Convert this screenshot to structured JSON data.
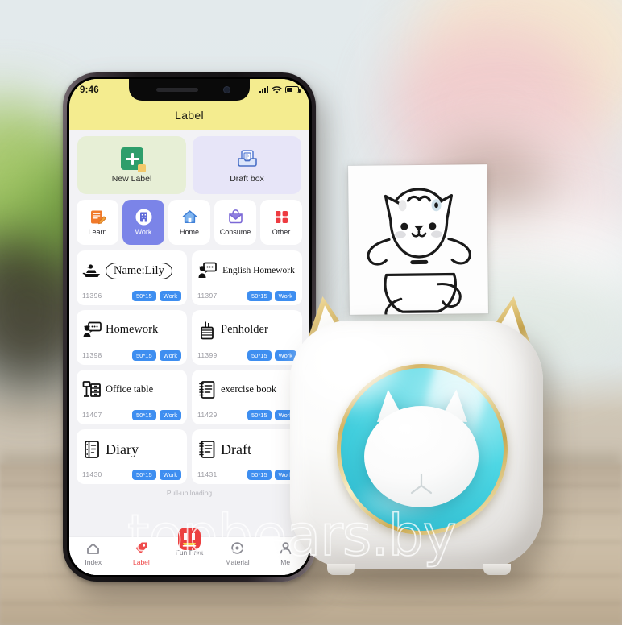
{
  "scene": {
    "watermark": "topbears.by",
    "background_colors": {
      "sky": "#dfe6e8",
      "table": "#c6b69e",
      "plant_green": "#6c9a3e",
      "bokeh_pink": "#f0c9cd"
    }
  },
  "phone": {
    "statusbar": {
      "time": "9:46",
      "signal_icon": "cellular-signal-icon",
      "wifi_icon": "wifi-icon",
      "battery_icon": "battery-icon"
    },
    "header": {
      "title": "Label",
      "bg": "#f4ec8f"
    }
  },
  "app": {
    "quick_actions": [
      {
        "label": "New Label",
        "icon": "new-label-icon",
        "bg": "#e7efd6"
      },
      {
        "label": "Draft box",
        "icon": "draft-box-icon",
        "bg": "#e7e5f8"
      }
    ],
    "categories": [
      {
        "label": "Learn",
        "icon": "notebook-pencil-icon",
        "active": false
      },
      {
        "label": "Work",
        "icon": "office-building-icon",
        "active": true
      },
      {
        "label": "Home",
        "icon": "house-icon",
        "active": false
      },
      {
        "label": "Consume",
        "icon": "shopping-bag-icon",
        "active": false
      },
      {
        "label": "Other",
        "icon": "grid-squares-icon",
        "active": false
      }
    ],
    "active_category_color": "#7b84e8",
    "labels": [
      {
        "id": "11396",
        "title": "Name:Lily",
        "icon": "person-boat-icon",
        "size": "50*15",
        "tag": "Work"
      },
      {
        "id": "11397",
        "title": "English Homework",
        "icon": "chat-bubble-icon",
        "size": "50*15",
        "tag": "Work"
      },
      {
        "id": "11398",
        "title": "Homework",
        "icon": "chat-bubble-icon",
        "size": "50*15",
        "tag": "Work"
      },
      {
        "id": "11399",
        "title": "Penholder",
        "icon": "penholder-icon",
        "size": "50*15",
        "tag": "Work"
      },
      {
        "id": "11407",
        "title": "Office table",
        "icon": "office-desk-icon",
        "size": "50*15",
        "tag": "Work"
      },
      {
        "id": "11429",
        "title": "exercise book",
        "icon": "notebook-icon",
        "size": "50*15",
        "tag": "Work"
      },
      {
        "id": "11430",
        "title": "Diary",
        "icon": "diary-book-icon",
        "size": "50*15",
        "tag": "Work"
      },
      {
        "id": "11431",
        "title": "Draft",
        "icon": "notebook-icon",
        "size": "50*15",
        "tag": "Work"
      }
    ],
    "badge_color": "#3e8ef0",
    "pull_hint": "Pull-up loading",
    "tabs": [
      {
        "label": "Index",
        "icon": "home-outline-icon",
        "active": false
      },
      {
        "label": "Label",
        "icon": "tag-icon",
        "active": true
      },
      {
        "label": "Fun Print",
        "icon": "fun-print-icon",
        "active": false
      },
      {
        "label": "Material",
        "icon": "material-icon",
        "active": false
      },
      {
        "label": "Me",
        "icon": "person-icon",
        "active": false
      }
    ],
    "tab_active_color": "#ef4b4b"
  },
  "printer": {
    "name": "cat-thermal-printer",
    "body_color": "#fdfdfb",
    "ring_color": "#d5b463",
    "lens_color": "#4fd7e4",
    "ears": "gold-cat-ears",
    "button_icon": "cat-face-button"
  },
  "paper": {
    "name": "printed-receipt-paper",
    "printed_art": "cartoon-cat-drawing"
  }
}
